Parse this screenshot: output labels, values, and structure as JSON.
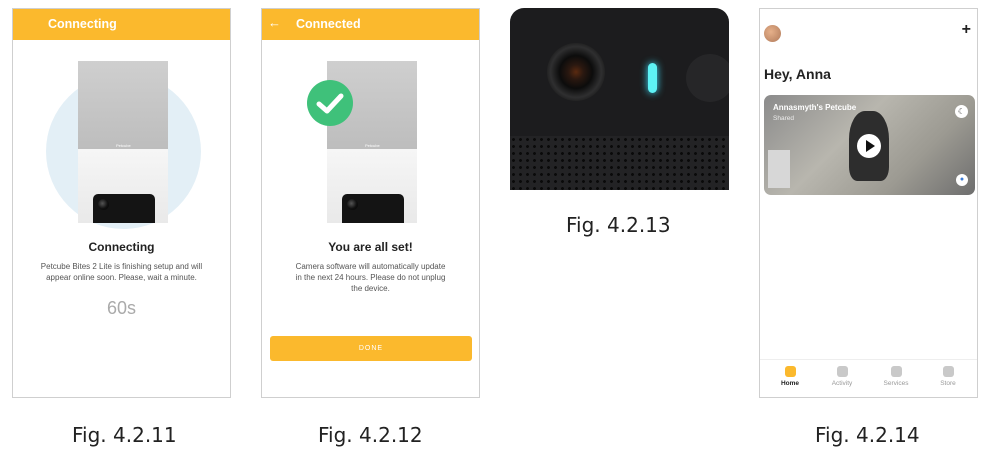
{
  "screen1": {
    "header": "Connecting",
    "device_brand": "Petcube",
    "title": "Connecting",
    "body": [
      "Petcube Bites 2 Lite is finishing setup and will",
      "appear online soon. Please, wait a minute."
    ],
    "countdown": "60s",
    "caption": "Fig. 4.2.11"
  },
  "screen2": {
    "back_icon": "arrow-left-icon",
    "header": "Connected",
    "device_brand": "Petcube",
    "title": "You are all set!",
    "body": [
      "Camera software will automatically update",
      "in the next 24 hours. Please do not unplug",
      "the device."
    ],
    "done_label": "DONE",
    "caption": "Fig. 4.2.12"
  },
  "photo": {
    "caption": "Fig. 4.2.13"
  },
  "screen4": {
    "add_icon": "plus-icon",
    "greeting": "Hey, Anna",
    "camera_name": "Annasmyth's Petcube",
    "camera_sub": "Shared",
    "nav": [
      "Home",
      "Activity",
      "Services",
      "Store"
    ],
    "colors": {
      "accent": "#fbb92d",
      "success": "#3fc17a"
    },
    "caption": "Fig. 4.2.14"
  }
}
